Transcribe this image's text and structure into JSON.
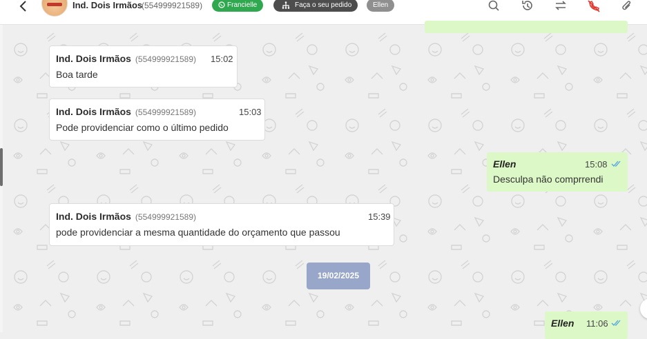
{
  "header": {
    "contact_name": "Ind. Dois Irmãos",
    "contact_phone": "(554999921589)",
    "tags": [
      {
        "label": "Francielle",
        "icon": "whatsapp-icon",
        "color": "#2fa84f"
      },
      {
        "label": "Faça o seu pedido",
        "icon": "sitemap-icon",
        "color": "#4d4d4d"
      },
      {
        "label": "Ellen",
        "color": "#8f8f8f"
      }
    ],
    "actions": [
      "search-icon",
      "history-icon",
      "transfer-icon",
      "end-call-icon",
      "paperclip-icon"
    ],
    "end_call_color": "#e0352b"
  },
  "messages": [
    {
      "direction": "in",
      "sender": "Ind. Dois Irmãos",
      "phone": "(554999921589)",
      "time": "15:02",
      "text": "Boa tarde"
    },
    {
      "direction": "in",
      "sender": "Ind. Dois Irmãos",
      "phone": "(554999921589)",
      "time": "15:03",
      "text": "Pode providenciar como o último pedido"
    },
    {
      "direction": "out",
      "sender": "Ellen",
      "time": "15:08",
      "text": "Desculpa não comprrendi",
      "status": "read"
    },
    {
      "direction": "in",
      "sender": "Ind. Dois Irmãos",
      "phone": "(554999921589)",
      "time": "15:39",
      "text": "pode providenciar a mesma quantidade do orçamento que passou"
    },
    {
      "direction": "out",
      "sender": "Ellen",
      "time": "11:06",
      "text": "",
      "status": "read"
    }
  ],
  "date_separator": "19/02/2025",
  "colors": {
    "outgoing_bubble": "#dcf8c6",
    "incoming_bubble": "#ffffff",
    "read_ticks": "#4fa3e0",
    "date_chip": "#97a6c9"
  }
}
